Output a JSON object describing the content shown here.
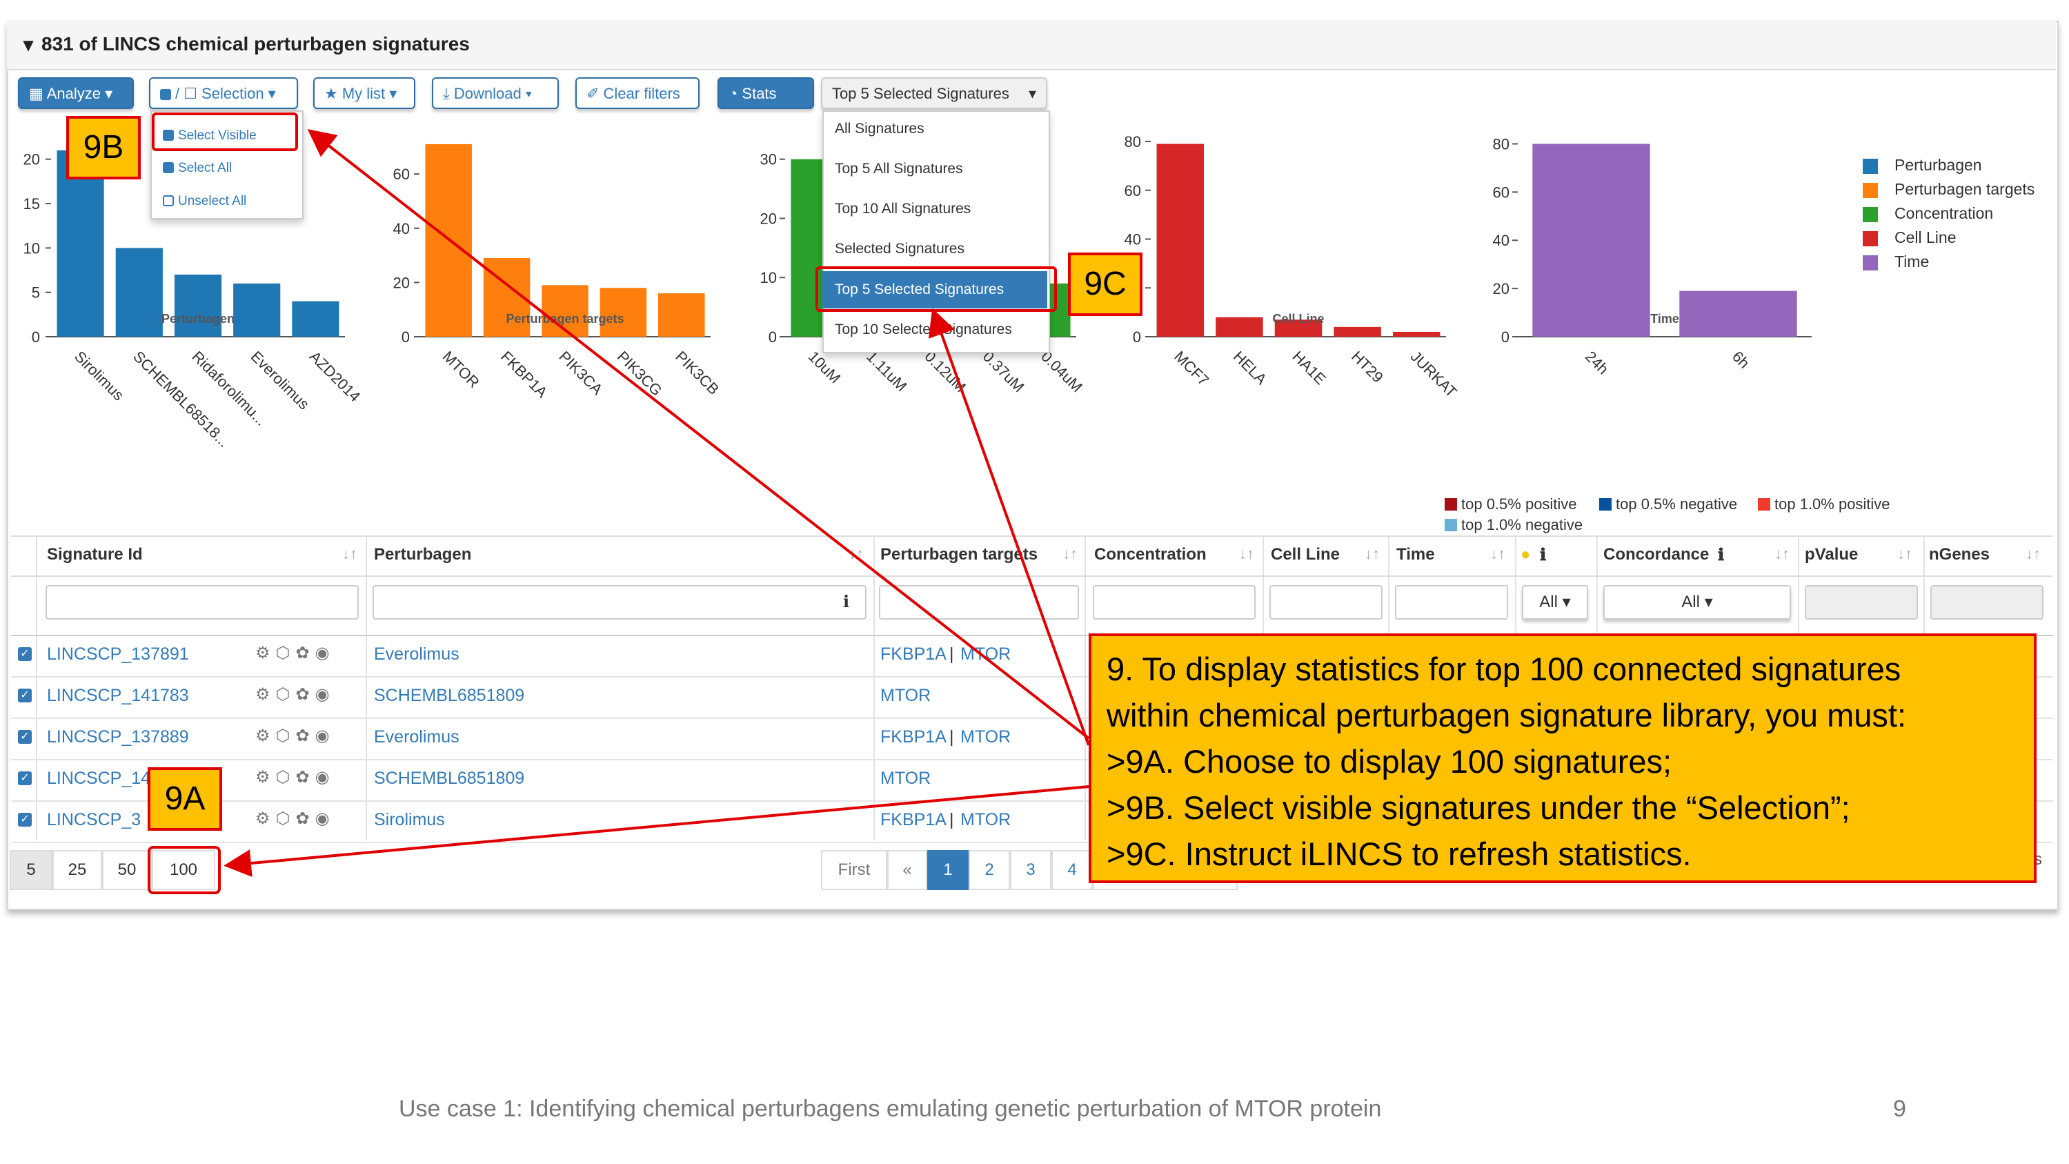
{
  "header": {
    "title": "831 of LINCS chemical perturbagen signatures"
  },
  "toolbar": {
    "analyze": "Analyze",
    "selection": "/ ☐ Selection",
    "mylist": "My list",
    "download": "Download",
    "clear": "Clear filters",
    "stats": "Stats",
    "stats_select": "Top 5 Selected Signatures"
  },
  "selection_menu": {
    "items": [
      "Select Visible",
      "Select All",
      "Unselect All"
    ]
  },
  "stats_menu": {
    "items": [
      "All Signatures",
      "Top 5 All Signatures",
      "Top 10 All Signatures",
      "Selected Signatures",
      "Top 5 Selected Signatures",
      "Top 10 Selected Signatures"
    ],
    "active_index": 4
  },
  "callouts": {
    "c9a": "9A",
    "c9b": "9B",
    "c9c": "9C",
    "main_lines": [
      "9. To display statistics for top 100 connected signatures",
      "within chemical perturbagen signature library, you must:",
      ">9A. Choose to display 100 signatures;",
      ">9B. Select visible signatures under the “Selection”;",
      ">9C. Instruct iLINCS to refresh statistics."
    ]
  },
  "chart_data": [
    {
      "type": "bar",
      "title": "Perturbagen",
      "color": "#1f77b4",
      "categories": [
        "Sirolimus",
        "SCHEMBL68518...",
        "Ridaforolimu...",
        "Everolimus",
        "AZD2014"
      ],
      "values": [
        21,
        10,
        7,
        6,
        4
      ],
      "ylim": [
        0,
        22
      ],
      "yticks": [
        0,
        5,
        10,
        15,
        20
      ]
    },
    {
      "type": "bar",
      "title": "Perturbagen targets",
      "color": "#ff7f0e",
      "categories": [
        "MTOR",
        "FKBP1A",
        "PIK3CA",
        "PIK3CG",
        "PIK3CB"
      ],
      "values": [
        71,
        29,
        19,
        18,
        16
      ],
      "ylim": [
        0,
        72
      ],
      "yticks": [
        0,
        20,
        40,
        60
      ]
    },
    {
      "type": "bar",
      "title": "Concentration",
      "color": "#2ca02c",
      "categories": [
        "10uM",
        "1.11uM",
        "0.12uM",
        "0.37uM",
        "0.04uM"
      ],
      "values": [
        30,
        0,
        0,
        0,
        9
      ],
      "ylim": [
        0,
        33
      ],
      "yticks": [
        0,
        10,
        20,
        30
      ]
    },
    {
      "type": "bar",
      "title": "Cell Line",
      "color": "#d62728",
      "categories": [
        "MCF7",
        "HELA",
        "HA1E",
        "HT29",
        "JURKAT"
      ],
      "values": [
        79,
        8,
        7,
        4,
        2
      ],
      "ylim": [
        0,
        80
      ],
      "yticks": [
        0,
        20,
        40,
        60,
        80
      ]
    },
    {
      "type": "bar",
      "title": "Time",
      "color": "#9467bd",
      "categories": [
        "24h",
        "6h"
      ],
      "values": [
        80,
        19
      ],
      "ylim": [
        0,
        81
      ],
      "yticks": [
        0,
        20,
        40,
        60,
        80
      ]
    }
  ],
  "legend": [
    {
      "label": "Perturbagen",
      "color": "#1f77b4"
    },
    {
      "label": "Perturbagen targets",
      "color": "#ff7f0e"
    },
    {
      "label": "Concentration",
      "color": "#2ca02c"
    },
    {
      "label": "Cell Line",
      "color": "#d62728"
    },
    {
      "label": "Time",
      "color": "#9467bd"
    }
  ],
  "conc_legend": [
    {
      "label": "top 0.5% positive",
      "color": "#a50f15"
    },
    {
      "label": "top 0.5% negative",
      "color": "#08519c"
    },
    {
      "label": "top 1.0% positive",
      "color": "#ef3b2c"
    },
    {
      "label": "top 1.0% negative",
      "color": "#6baed6"
    }
  ],
  "table": {
    "columns": [
      "Signature Id",
      "Perturbagen",
      "Perturbagen targets",
      "Concentration",
      "Cell Line",
      "Time",
      "",
      "Concordance",
      "pValue",
      "nGenes"
    ],
    "filter_all": "All",
    "rows": [
      {
        "id": "LINCSCP_137891",
        "perturbagen": "Everolimus",
        "t1": "FKBP1A",
        "sep": "|",
        "t2": "MTOR"
      },
      {
        "id": "LINCSCP_141783",
        "perturbagen": "SCHEMBL6851809",
        "t1": "MTOR",
        "sep": "",
        "t2": ""
      },
      {
        "id": "LINCSCP_137889",
        "perturbagen": "Everolimus",
        "t1": "FKBP1A",
        "sep": "|",
        "t2": "MTOR"
      },
      {
        "id": "LINCSCP_14",
        "perturbagen": "SCHEMBL6851809",
        "t1": "MTOR",
        "sep": "",
        "t2": ""
      },
      {
        "id": "LINCSCP_3",
        "perturbagen": "Sirolimus",
        "t1": "FKBP1A",
        "sep": "|",
        "t2": "MTOR"
      }
    ],
    "page_sizes": [
      "5",
      "25",
      "50",
      "100"
    ],
    "pagination": [
      "First",
      "«",
      "1",
      "2",
      "3",
      "4"
    ],
    "trailing": "s"
  },
  "footer": {
    "caption": "Use case 1: Identifying chemical perturbagens emulating genetic perturbation of MTOR protein",
    "page_number": "9"
  }
}
